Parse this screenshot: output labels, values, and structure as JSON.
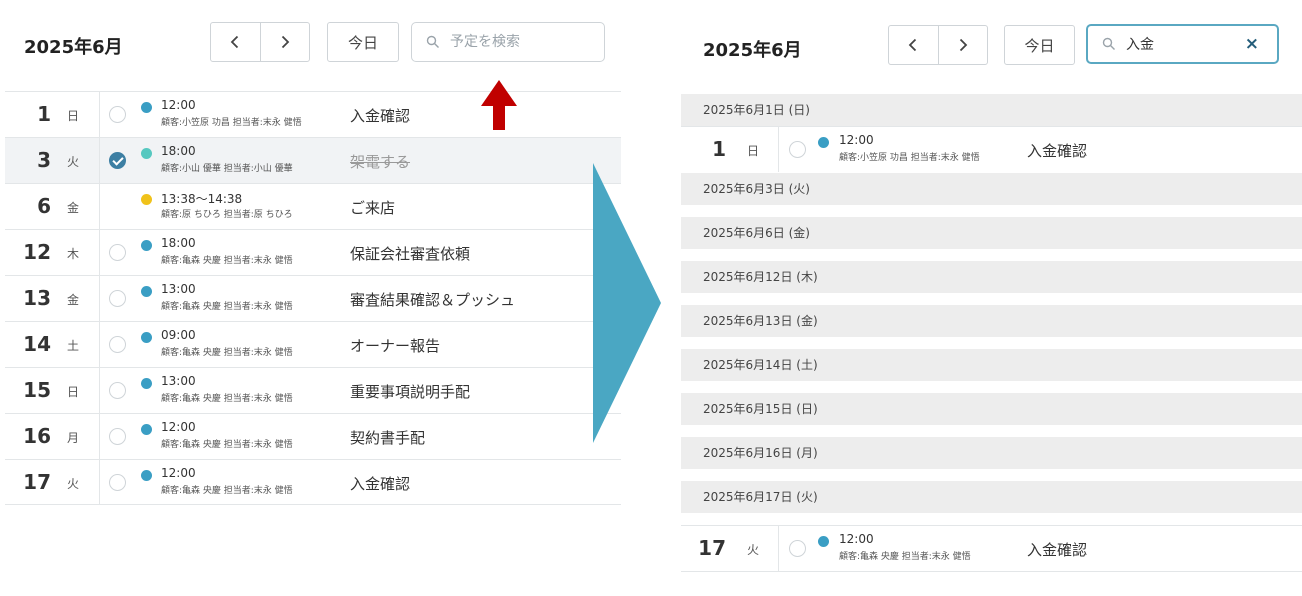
{
  "colors": {
    "accent": "#3d7fa3",
    "dot_blue": "#3a9ec4",
    "dot_teal": "#56c8c0",
    "dot_yellow": "#f0c21a",
    "arrow_blue": "#4aa7c3",
    "arrow_red": "#c00000"
  },
  "left": {
    "month_title": "2025年6月",
    "nav_prev_icon": "chevron-left-icon",
    "nav_next_icon": "chevron-right-icon",
    "today_label": "今日",
    "search_placeholder": "予定を検索",
    "rows": [
      {
        "day": "1",
        "weekday": "日",
        "time": "12:00",
        "customer": "顧客:小笠原 功昌 担当者:末永 健悟",
        "title": "入金確認"
      },
      {
        "day": "3",
        "weekday": "火",
        "time": "18:00",
        "customer": "顧客:小山 優華 担当者:小山 優華",
        "title": "架電する"
      },
      {
        "day": "6",
        "weekday": "金",
        "time": "13:38〜14:38",
        "customer": "顧客:原 ちひろ 担当者:原 ちひろ",
        "title": "ご来店"
      },
      {
        "day": "12",
        "weekday": "木",
        "time": "18:00",
        "customer": "顧客:亀森 央慶 担当者:末永 健悟",
        "title": "保証会社審査依頼"
      },
      {
        "day": "13",
        "weekday": "金",
        "time": "13:00",
        "customer": "顧客:亀森 央慶 担当者:末永 健悟",
        "title": "審査結果確認＆プッシュ"
      },
      {
        "day": "14",
        "weekday": "土",
        "time": "09:00",
        "customer": "顧客:亀森 央慶 担当者:末永 健悟",
        "title": "オーナー報告"
      },
      {
        "day": "15",
        "weekday": "日",
        "time": "13:00",
        "customer": "顧客:亀森 央慶 担当者:末永 健悟",
        "title": "重要事項説明手配"
      },
      {
        "day": "16",
        "weekday": "月",
        "time": "12:00",
        "customer": "顧客:亀森 央慶 担当者:末永 健悟",
        "title": "契約書手配"
      },
      {
        "day": "17",
        "weekday": "火",
        "time": "12:00",
        "customer": "顧客:亀森 央慶 担当者:末永 健悟",
        "title": "入金確認"
      }
    ]
  },
  "right": {
    "month_title": "2025年6月",
    "today_label": "今日",
    "search_value": "入金",
    "clear_label": "×",
    "sections": [
      {
        "header": "2025年6月1日 (日)",
        "row": {
          "day": "1",
          "weekday": "日",
          "time": "12:00",
          "customer": "顧客:小笠原 功昌 担当者:末永 健悟",
          "title": "入金確認"
        }
      },
      {
        "header": "2025年6月3日 (火)"
      },
      {
        "header": "2025年6月6日 (金)"
      },
      {
        "header": "2025年6月12日 (木)"
      },
      {
        "header": "2025年6月13日 (金)"
      },
      {
        "header": "2025年6月14日 (土)"
      },
      {
        "header": "2025年6月15日 (日)"
      },
      {
        "header": "2025年6月16日 (月)"
      },
      {
        "header": "2025年6月17日 (火)",
        "row": {
          "day": "17",
          "weekday": "火",
          "time": "12:00",
          "customer": "顧客:亀森 央慶 担当者:末永 健悟",
          "title": "入金確認"
        }
      }
    ]
  }
}
